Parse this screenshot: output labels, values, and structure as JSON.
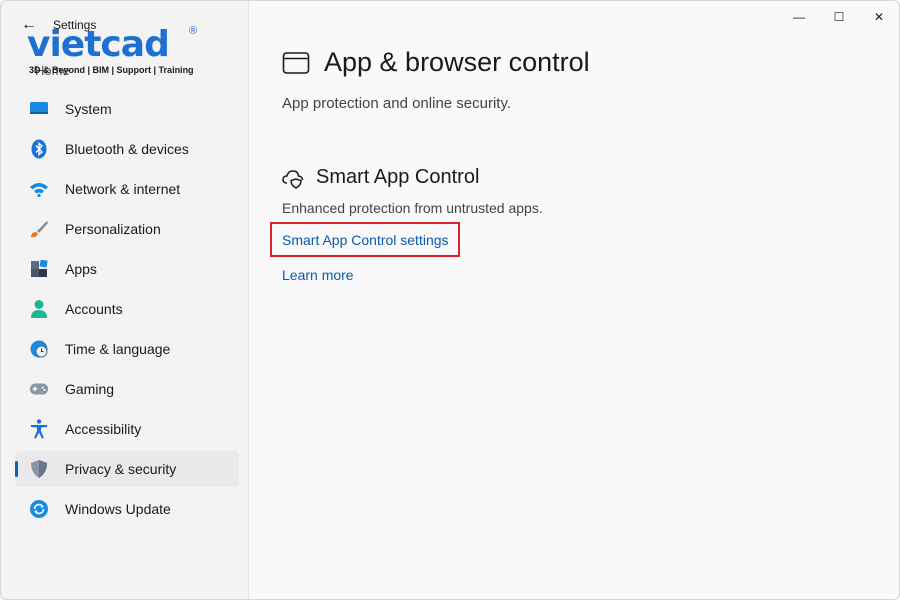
{
  "window": {
    "app_title": "Settings",
    "controls": {
      "minimize_glyph": "—",
      "maximize_glyph": "☐",
      "close_glyph": "✕"
    }
  },
  "logo": {
    "text": "vietcad",
    "registered": "®",
    "tagline": "3D & Beyond | BIM | Support | Training",
    "color": "#1e6fd1"
  },
  "sidebar": {
    "back_glyph": "←",
    "home_label": "Home",
    "items": [
      {
        "label": "System",
        "icon": "monitor-icon"
      },
      {
        "label": "Bluetooth & devices",
        "icon": "bluetooth-icon"
      },
      {
        "label": "Network & internet",
        "icon": "wifi-icon"
      },
      {
        "label": "Personalization",
        "icon": "brush-icon"
      },
      {
        "label": "Apps",
        "icon": "apps-icon"
      },
      {
        "label": "Accounts",
        "icon": "person-icon"
      },
      {
        "label": "Time & language",
        "icon": "globe-clock-icon"
      },
      {
        "label": "Gaming",
        "icon": "gamepad-icon"
      },
      {
        "label": "Accessibility",
        "icon": "accessibility-icon"
      },
      {
        "label": "Privacy & security",
        "icon": "shield-icon",
        "active": true
      },
      {
        "label": "Windows Update",
        "icon": "update-icon"
      }
    ]
  },
  "main": {
    "page_title": "App & browser control",
    "page_subtitle": "App protection and online security.",
    "section": {
      "title": "Smart App Control",
      "description": "Enhanced protection from untrusted apps.",
      "settings_link": "Smart App Control settings",
      "learn_more": "Learn more"
    },
    "accent_color": "#0067c0",
    "highlight_color": "#d6242d"
  }
}
